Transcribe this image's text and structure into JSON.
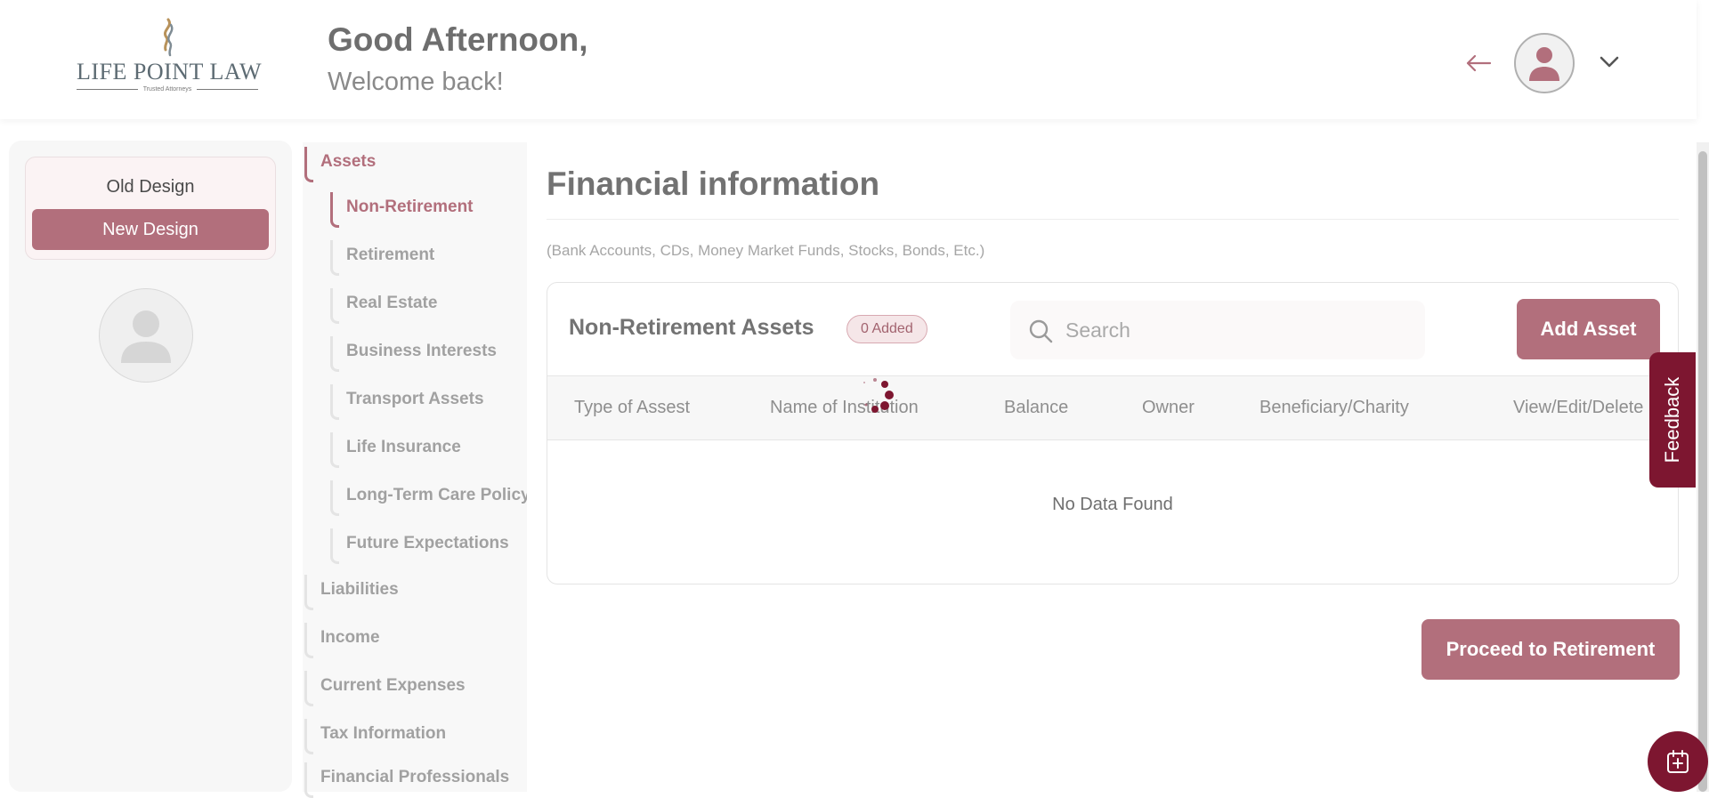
{
  "header": {
    "logo": {
      "name": "LIFE POINT LAW",
      "tagline": "Trusted Attorneys"
    },
    "greeting": "Good Afternoon,",
    "welcome": "Welcome back!",
    "icons": {
      "back": "arrow-left-icon",
      "avatar": "user-avatar-icon",
      "menu": "chevron-down-icon"
    }
  },
  "design_switch": {
    "old": "Old Design",
    "new": "New Design",
    "selected": "New Design"
  },
  "nav": {
    "items": [
      {
        "label": "Assets",
        "level": "main",
        "active": true
      },
      {
        "label": "Non-Retirement",
        "level": "sub",
        "active": true
      },
      {
        "label": "Retirement",
        "level": "sub",
        "active": false
      },
      {
        "label": "Real Estate",
        "level": "sub",
        "active": false
      },
      {
        "label": "Business Interests",
        "level": "sub",
        "active": false
      },
      {
        "label": "Transport Assets",
        "level": "sub",
        "active": false
      },
      {
        "label": "Life Insurance",
        "level": "sub",
        "active": false
      },
      {
        "label": "Long-Term Care Policy",
        "level": "sub",
        "active": false
      },
      {
        "label": "Future Expectations",
        "level": "sub",
        "active": false
      },
      {
        "label": "Liabilities",
        "level": "main",
        "active": false
      },
      {
        "label": "Income",
        "level": "main",
        "active": false
      },
      {
        "label": "Current Expenses",
        "level": "main",
        "active": false
      },
      {
        "label": "Tax Information",
        "level": "main",
        "active": false
      },
      {
        "label": "Financial Professionals",
        "level": "main",
        "active": false
      }
    ]
  },
  "main": {
    "title": "Financial information",
    "note": "(Bank Accounts, CDs, Money Market Funds, Stocks, Bonds, Etc.)",
    "card": {
      "title": "Non-Retirement Assets",
      "badge": "0 Added",
      "search_placeholder": "Search",
      "search_value": "",
      "add_button": "Add Asset",
      "columns": [
        "Type of Assest",
        "Name of Institution",
        "Balance",
        "Owner",
        "Beneficiary/Charity",
        "View/Edit/Delete"
      ],
      "rows": [],
      "empty_text": "No Data Found"
    },
    "proceed_button": "Proceed to Retirement"
  },
  "feedback_label": "Feedback",
  "colors": {
    "accent": "#b26f7c",
    "brand_dark": "#7d1630",
    "text": "#6e6e6e",
    "muted": "#a1a1a1"
  }
}
